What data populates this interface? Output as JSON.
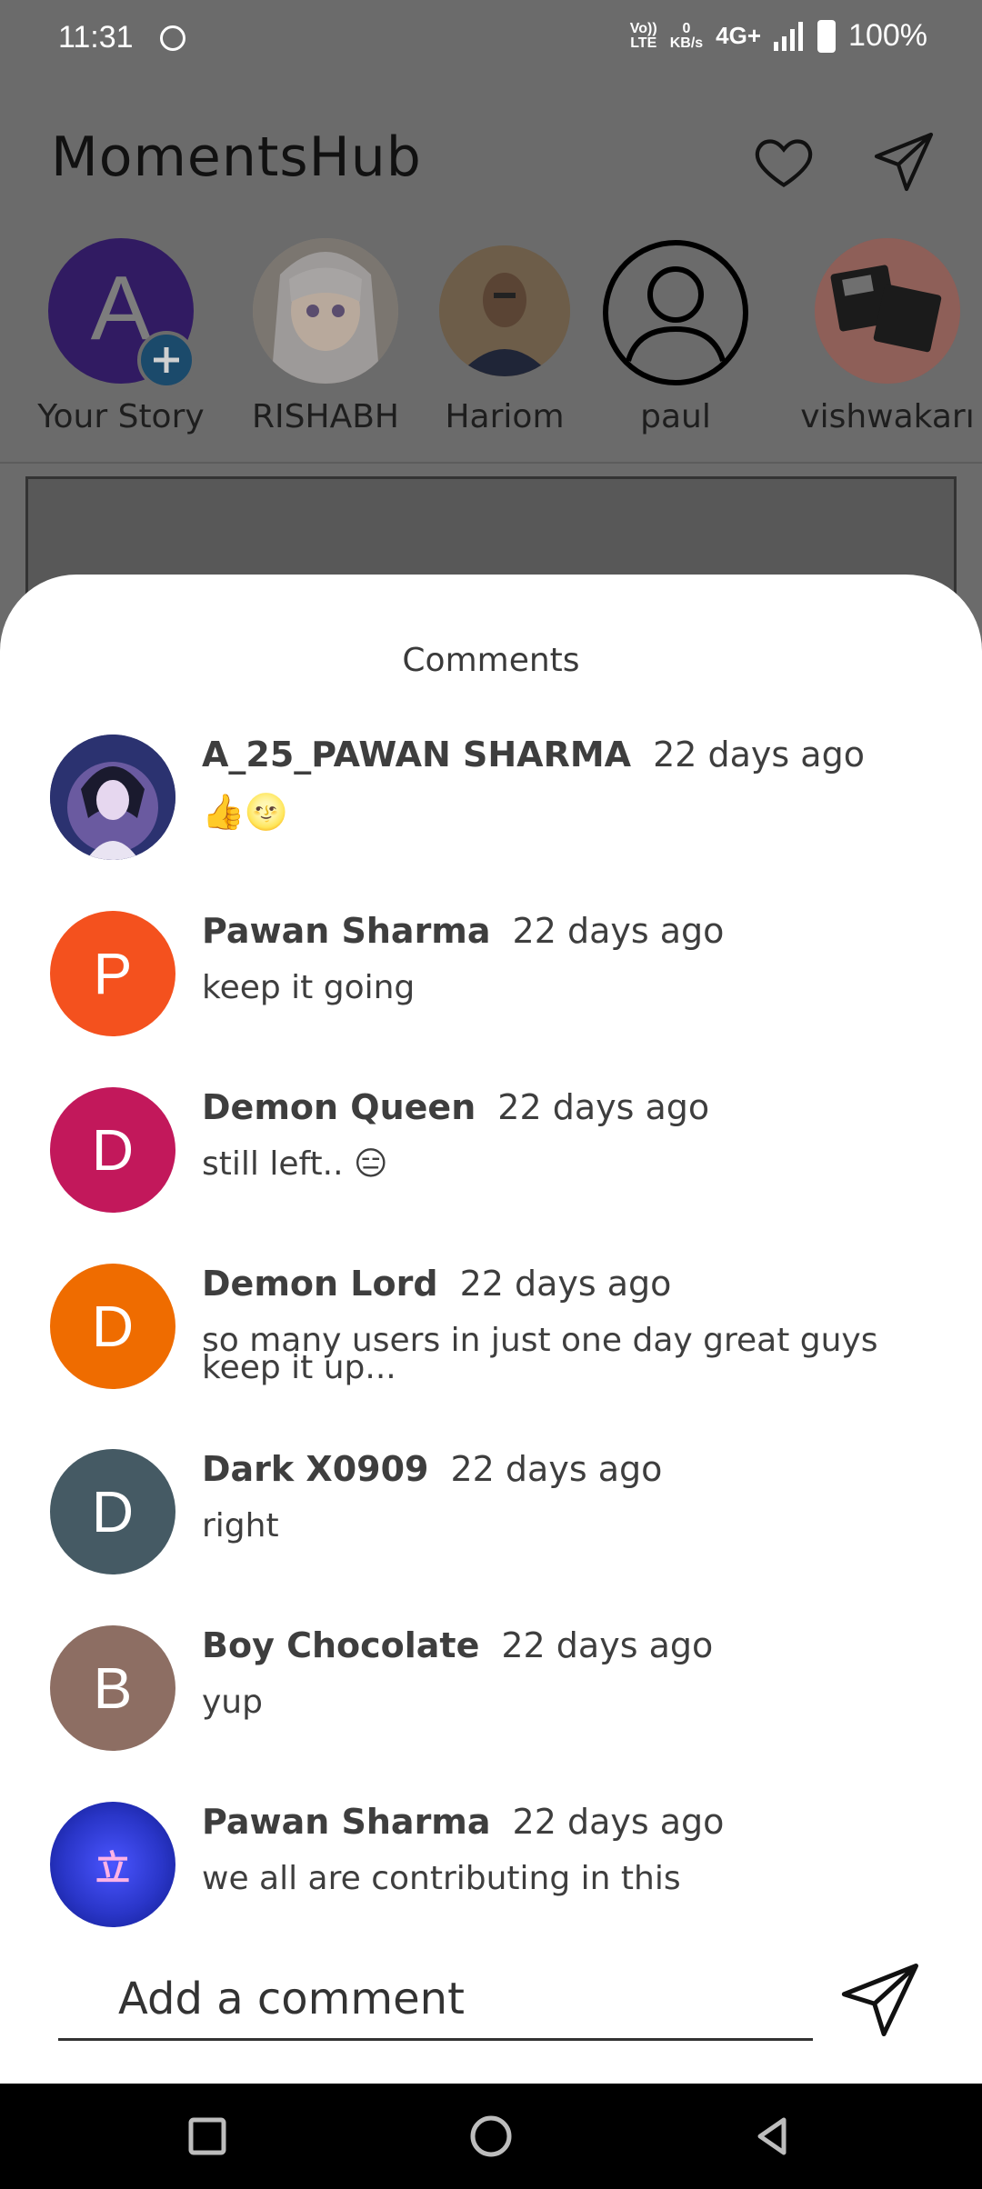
{
  "status_bar": {
    "time": "11:31",
    "network_label_top": "Vo))",
    "network_label_bottom": "LTE",
    "speed_value": "0",
    "speed_unit": "KB/s",
    "network_type": "4G+",
    "battery": "100%"
  },
  "header": {
    "app_title": "MomentsHub",
    "icons": [
      "heart-icon",
      "send-icon"
    ]
  },
  "stories": [
    {
      "name": "Your Story",
      "initial": "A",
      "color": "#311b62"
    },
    {
      "name": "RISHABH"
    },
    {
      "name": "Hariom"
    },
    {
      "name": "paul"
    },
    {
      "name": "vishwakarı"
    }
  ],
  "comments_sheet": {
    "title": "Comments",
    "comments": [
      {
        "user": "A_25_PAWAN SHARMA",
        "time": "22 days ago",
        "text": "",
        "emoji_text": "👍🌝",
        "initial": "",
        "color": "#2a2f6b"
      },
      {
        "user": "Pawan Sharma",
        "time": "22 days ago",
        "text": "keep it going",
        "initial": "P",
        "color": "#f4511e"
      },
      {
        "user": "Demon Queen",
        "time": "22 days ago",
        "text": "still left.. 😑",
        "initial": "D",
        "color": "#c2185b"
      },
      {
        "user": "Demon Lord",
        "time": "22 days ago",
        "text": "so many users in just one day great guys keep it up...",
        "initial": "D",
        "color": "#ef6c00"
      },
      {
        "user": "Dark X0909",
        "time": "22 days ago",
        "text": "right",
        "initial": "D",
        "color": "#455a64"
      },
      {
        "user": "Boy Chocolate",
        "time": "22 days ago",
        "text": "yup",
        "initial": "B",
        "color": "#8d6e63"
      },
      {
        "user": "Pawan Sharma",
        "time": "22 days ago",
        "text": "we all are contributing in this",
        "initial": "立",
        "color": "#2a36c9"
      }
    ],
    "input_placeholder": "Add a comment"
  },
  "nav_bar": [
    "recents-icon",
    "home-icon",
    "back-icon"
  ]
}
